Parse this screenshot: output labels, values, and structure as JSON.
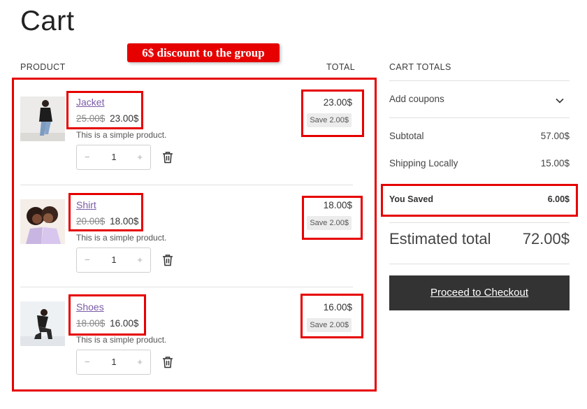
{
  "page": {
    "title": "Cart"
  },
  "annotation": {
    "callout_text": "6$ discount to the group"
  },
  "table": {
    "product_header": "PRODUCT",
    "total_header": "TOTAL"
  },
  "items": [
    {
      "name": "Jacket",
      "old_price": "25.00$",
      "new_price": "23.00$",
      "description": "This is a simple product.",
      "quantity": "1",
      "line_total": "23.00$",
      "save_label": "Save 2.00$"
    },
    {
      "name": "Shirt",
      "old_price": "20.00$",
      "new_price": "18.00$",
      "description": "This is a simple product.",
      "quantity": "1",
      "line_total": "18.00$",
      "save_label": "Save 2.00$"
    },
    {
      "name": "Shoes",
      "old_price": "18.00$",
      "new_price": "16.00$",
      "description": "This is a simple product.",
      "quantity": "1",
      "line_total": "16.00$",
      "save_label": "Save 2.00$"
    }
  ],
  "quantity_controls": {
    "minus": "−",
    "plus": "+"
  },
  "cart_totals": {
    "header": "CART TOTALS",
    "coupons_label": "Add coupons",
    "subtotal_label": "Subtotal",
    "subtotal_value": "57.00$",
    "shipping_label": "Shipping Locally",
    "shipping_value": "15.00$",
    "saved_label": "You Saved",
    "saved_value": "6.00$",
    "estimated_label": "Estimated total",
    "estimated_value": "72.00$",
    "checkout_label": "Proceed to Checkout"
  },
  "colors": {
    "highlight_red": "#e60000",
    "link_purple": "#7a5ba6",
    "button_dark": "#333333"
  },
  "icons": [
    "chevron-down-icon",
    "trash-icon"
  ]
}
